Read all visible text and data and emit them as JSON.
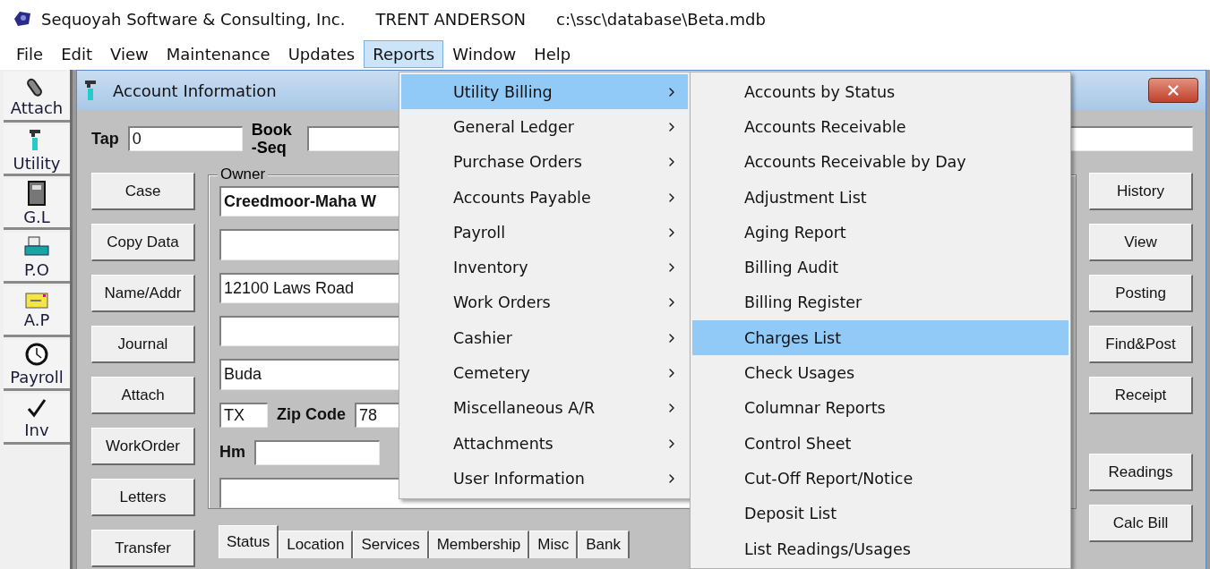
{
  "app_title": {
    "company": "Sequoyah Software & Consulting, Inc.",
    "user": "TRENT ANDERSON",
    "path": "c:\\ssc\\database\\Beta.mdb"
  },
  "menu_bar": [
    {
      "label": "File",
      "selected": false
    },
    {
      "label": "Edit",
      "selected": false
    },
    {
      "label": "View",
      "selected": false
    },
    {
      "label": "Maintenance",
      "selected": false
    },
    {
      "label": "Updates",
      "selected": false
    },
    {
      "label": "Reports",
      "selected": true
    },
    {
      "label": "Window",
      "selected": false
    },
    {
      "label": "Help",
      "selected": false
    }
  ],
  "toolbar": [
    {
      "label": "Attach",
      "kind": "paperclip"
    },
    {
      "label": "Utility",
      "kind": "faucet"
    },
    {
      "label": "G.L",
      "kind": "ledger"
    },
    {
      "label": "P.O",
      "kind": "printer"
    },
    {
      "label": "A.P",
      "kind": "envelope"
    },
    {
      "label": "Payroll",
      "kind": "clock"
    },
    {
      "label": "Inv",
      "kind": "check"
    }
  ],
  "child_window": {
    "title": "Account Information",
    "tap_label": "Tap",
    "tap_value": "0",
    "book_seq_label": "Book -Seq",
    "left_buttons": [
      "Case",
      "Copy Data",
      "Name/Addr",
      "Journal",
      "Attach",
      "WorkOrder",
      "Letters",
      "Transfer"
    ],
    "owner": {
      "label": "Owner",
      "name": "Creedmoor-Maha W",
      "address": "12100 Laws Road",
      "city": "Buda",
      "state": "TX",
      "zip_label": "Zip Code",
      "zip": "78",
      "phone_label": "Hm"
    },
    "right_buttons": [
      "History",
      "View",
      "Posting",
      "Find&Post",
      "Receipt",
      "Readings",
      "Calc Bill"
    ],
    "tabs": [
      {
        "label": "Status",
        "selected": true
      },
      {
        "label": "Location",
        "selected": false
      },
      {
        "label": "Services",
        "selected": false
      },
      {
        "label": "Membership",
        "selected": false
      },
      {
        "label": "Misc",
        "selected": false
      },
      {
        "label": "Bank",
        "selected": false
      }
    ]
  },
  "reports_menu": [
    {
      "label": "Utility Billing",
      "selected": true
    },
    {
      "label": "General Ledger",
      "selected": false
    },
    {
      "label": "Purchase Orders",
      "selected": false
    },
    {
      "label": "Accounts Payable",
      "selected": false
    },
    {
      "label": "Payroll",
      "selected": false
    },
    {
      "label": "Inventory",
      "selected": false
    },
    {
      "label": "Work Orders",
      "selected": false
    },
    {
      "label": "Cashier",
      "selected": false
    },
    {
      "label": "Cemetery",
      "selected": false
    },
    {
      "label": "Miscellaneous A/R",
      "selected": false
    },
    {
      "label": "Attachments",
      "selected": false
    },
    {
      "label": "User Information",
      "selected": false
    }
  ],
  "utility_billing_submenu": [
    {
      "label": "Accounts by Status",
      "selected": false
    },
    {
      "label": "Accounts Receivable",
      "selected": false
    },
    {
      "label": "Accounts Receivable by Day",
      "selected": false
    },
    {
      "label": "Adjustment List",
      "selected": false
    },
    {
      "label": "Aging Report",
      "selected": false
    },
    {
      "label": "Billing Audit",
      "selected": false
    },
    {
      "label": "Billing Register",
      "selected": false
    },
    {
      "label": "Charges List",
      "selected": true
    },
    {
      "label": "Check Usages",
      "selected": false
    },
    {
      "label": "Columnar Reports",
      "selected": false
    },
    {
      "label": "Control Sheet",
      "selected": false
    },
    {
      "label": "Cut-Off Report/Notice",
      "selected": false
    },
    {
      "label": "Deposit List",
      "selected": false
    },
    {
      "label": "List Readings/Usages",
      "selected": false
    }
  ]
}
